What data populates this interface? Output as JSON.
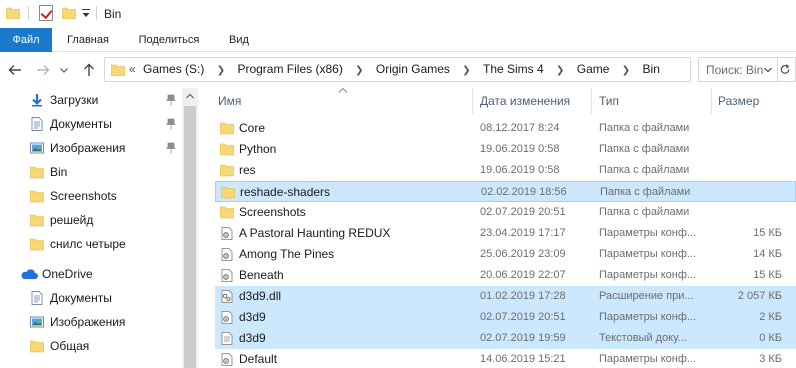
{
  "window": {
    "title": "Bin"
  },
  "ribbon": {
    "tabs": [
      "Файл",
      "Главная",
      "Поделиться",
      "Вид"
    ]
  },
  "address": {
    "overflow": "«",
    "crumbs": [
      "Games (S:)",
      "Program Files (x86)",
      "Origin Games",
      "The Sims 4",
      "Game",
      "Bin"
    ],
    "search_placeholder": "Поиск: Bin"
  },
  "nav_pane": {
    "quick_access": [
      {
        "label": "Загрузки",
        "icon": "download-arrow-icon",
        "pinned": true
      },
      {
        "label": "Документы",
        "icon": "document-icon",
        "pinned": true
      },
      {
        "label": "Изображения",
        "icon": "pictures-icon",
        "pinned": true
      },
      {
        "label": "Bin",
        "icon": "folder-icon",
        "pinned": false
      },
      {
        "label": "Screenshots",
        "icon": "folder-icon",
        "pinned": false
      },
      {
        "label": "решейд",
        "icon": "folder-icon",
        "pinned": false
      },
      {
        "label": "снилс четыре",
        "icon": "folder-icon",
        "pinned": false
      }
    ],
    "onedrive": {
      "label": "OneDrive",
      "items": [
        {
          "label": "Документы",
          "icon": "document-icon"
        },
        {
          "label": "Изображения",
          "icon": "pictures-icon"
        },
        {
          "label": "Общая",
          "icon": "folder-icon"
        }
      ]
    }
  },
  "file_list": {
    "columns": [
      "Имя",
      "Дата изменения",
      "Тип",
      "Размер"
    ],
    "rows": [
      {
        "name": "Core",
        "date": "08.12.2017 8:24",
        "type": "Папка с файлами",
        "size": "",
        "icon": "folder-icon",
        "selected": false
      },
      {
        "name": "Python",
        "date": "19.06.2019 0:58",
        "type": "Папка с файлами",
        "size": "",
        "icon": "folder-icon",
        "selected": false
      },
      {
        "name": "res",
        "date": "19.06.2019 0:58",
        "type": "Папка с файлами",
        "size": "",
        "icon": "folder-icon",
        "selected": false
      },
      {
        "name": "reshade-shaders",
        "date": "02.02.2019 18:56",
        "type": "Папка с файлами",
        "size": "",
        "icon": "folder-icon",
        "selected": true
      },
      {
        "name": "Screenshots",
        "date": "02.07.2019 20:51",
        "type": "Папка с файлами",
        "size": "",
        "icon": "folder-icon",
        "selected": false
      },
      {
        "name": "A Pastoral Haunting REDUX",
        "date": "23.04.2019 17:17",
        "type": "Параметры конф...",
        "size": "15 КБ",
        "icon": "config-file-icon",
        "selected": false
      },
      {
        "name": "Among The Pines",
        "date": "25.06.2019 23:09",
        "type": "Параметры конф...",
        "size": "14 КБ",
        "icon": "config-file-icon",
        "selected": false
      },
      {
        "name": "Beneath",
        "date": "20.06.2019 22:07",
        "type": "Параметры конф...",
        "size": "15 КБ",
        "icon": "config-file-icon",
        "selected": false
      },
      {
        "name": "d3d9.dll",
        "date": "01.02.2019 17:28",
        "type": "Расширение при...",
        "size": "2 057 КБ",
        "icon": "dll-file-icon",
        "selected": true
      },
      {
        "name": "d3d9",
        "date": "02.07.2019 20:51",
        "type": "Параметры конф...",
        "size": "2 КБ",
        "icon": "config-file-icon",
        "selected": true
      },
      {
        "name": "d3d9",
        "date": "02.07.2019 19:59",
        "type": "Текстовый доку...",
        "size": "0 КБ",
        "icon": "text-file-icon",
        "selected": true
      },
      {
        "name": "Default",
        "date": "14.06.2019 15:21",
        "type": "Параметры конф...",
        "size": "3 КБ",
        "icon": "config-file-icon",
        "selected": false
      }
    ]
  },
  "colors": {
    "accent": "#1979ca",
    "selection": "#cce8ff",
    "selection_border": "#99d1ff",
    "folder": "#f8d775"
  }
}
